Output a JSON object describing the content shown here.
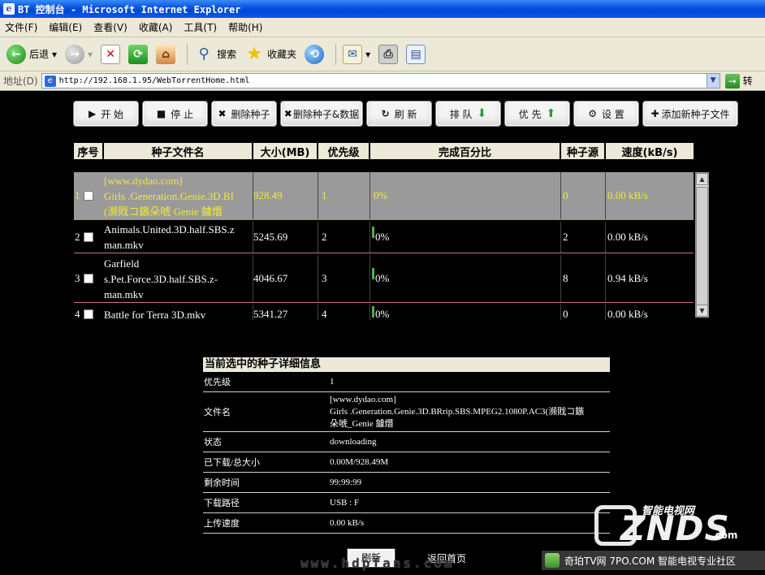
{
  "window": {
    "title": "BT 控制台 - Microsoft Internet Explorer",
    "title_icon_glyph": "e"
  },
  "menu": [
    "文件(F)",
    "编辑(E)",
    "查看(V)",
    "收藏(A)",
    "工具(T)",
    "帮助(H)"
  ],
  "toolbar": {
    "back": "后退",
    "search": "搜索",
    "favorites": "收藏夹"
  },
  "address": {
    "label": "地址(D)",
    "url": "http://192.168.1.95/WebTorrentHome.html",
    "go_label": "转"
  },
  "actions": {
    "start": "开 始",
    "stop": "停 止",
    "delete_torrent": "删除种子",
    "delete_torrent_data": "删除种子&数据",
    "refresh": "刷 新",
    "queue": "排 队",
    "priority": "优 先",
    "settings": "设 置",
    "add_torrent": "添加新种子文件"
  },
  "table": {
    "headers": [
      "序号",
      "种子文件名",
      "大小(MB)",
      "优先级",
      "完成百分比",
      "种子源",
      "速度(kB/s)"
    ],
    "rows": [
      {
        "index": "1",
        "name": "[www.dydao.com] Girls .Generation.Genie.3D.BRrip.SBS.MPEG2.1080P.AC3(濒戝コ鏃朵唬_Genie 鐪熸",
        "name_display": "[www.dydao.com]\nGirls .Generation.Genie.3D.BI\n(濒戝コ鏃朵唬 Genie 鐪熸",
        "size": "928.49",
        "priority": "1",
        "percent": "0%",
        "seeds": "0",
        "speed": "0.00 kB/s",
        "selected": true
      },
      {
        "index": "2",
        "name": "Animals.United.3D.half.SBS.z-man.mkv",
        "name_display": "Animals.United.3D.half.SBS.z\nman.mkv",
        "size": "5245.69",
        "priority": "2",
        "percent": "0%",
        "seeds": "2",
        "speed": "0.00 kB/s",
        "selected": false
      },
      {
        "index": "3",
        "name": "Garfield s.Pet.Force.3D.half.SBS.z-man.mkv",
        "name_display": "Garfield\ns.Pet.Force.3D.half.SBS.z-\nman.mkv",
        "size": "4046.67",
        "priority": "3",
        "percent": "0%",
        "seeds": "8",
        "speed": "0.94 kB/s",
        "selected": false
      },
      {
        "index": "4",
        "name": "Battle for Terra 3D.mkv",
        "name_display": "Battle for Terra 3D.mkv",
        "size": "5341.27",
        "priority": "4",
        "percent": "0%",
        "seeds": "0",
        "speed": "0.00 kB/s",
        "selected": false
      }
    ]
  },
  "details": {
    "title": "当前选中的种子详细信息",
    "fields": [
      {
        "label": "优先级",
        "value": "1"
      },
      {
        "label": "文件名",
        "value": "[www.dydao.com]\nGirls .Generation.Genie.3D.BRrip.SBS.MPEG2.1080P.AC3(濒戝コ鏃\n朵唬_Genie 鐪熸"
      },
      {
        "label": "状态",
        "value": "downloading"
      },
      {
        "label": "已下载/总大小",
        "value": "0.00M/928.49M"
      },
      {
        "label": "剩余时间",
        "value": "99:99:99"
      },
      {
        "label": "下载路径",
        "value": "USB : F"
      },
      {
        "label": "上传速度",
        "value": "0.00 kB/s"
      }
    ]
  },
  "bottom": {
    "refresh_button": "刷新",
    "back_link": "返回首页"
  },
  "watermarks": {
    "site": "www.hdpfans.com",
    "brand_cn": "智能电视网",
    "brand": "ZNDS",
    "brand_tld": ".com",
    "footer": "奇珀TV网 7PO.COM 智能电视专业社区"
  },
  "colors": {
    "selected_row_bg": "#9a9a9a",
    "selected_row_text": "#f2ea38",
    "row_text": "#ffffff",
    "header_bg": "#ece9d8",
    "progress_fill": "#4caf50",
    "row_divider": "#c87878"
  }
}
